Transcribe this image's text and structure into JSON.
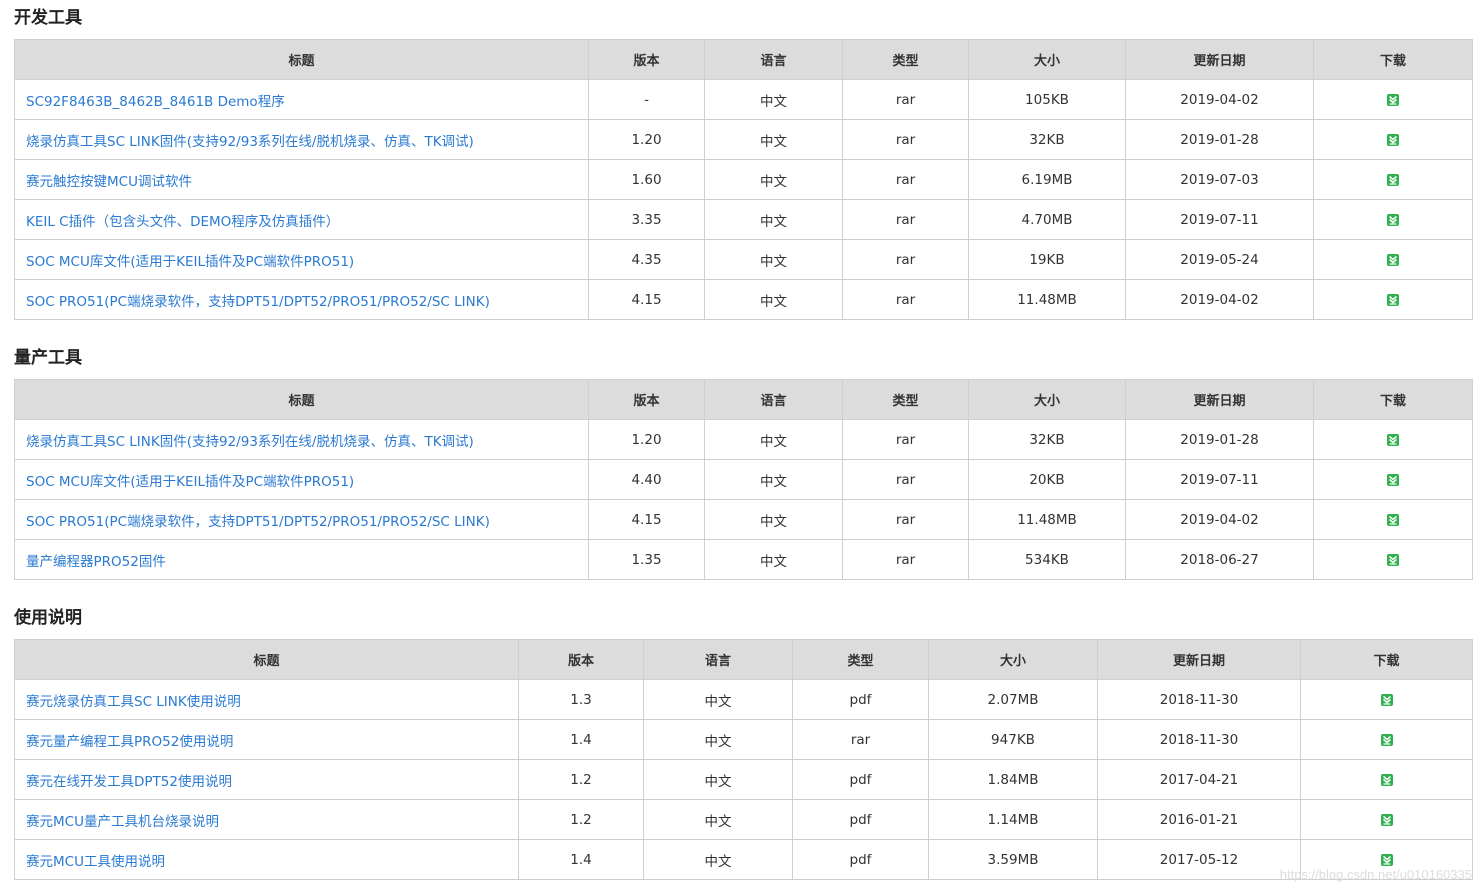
{
  "sections": [
    {
      "title": "开发工具",
      "headers": [
        "标题",
        "版本",
        "语言",
        "类型",
        "大小",
        "更新日期",
        "下载"
      ],
      "rows": [
        {
          "title": "SC92F8463B_8462B_8461B Demo程序",
          "version": "-",
          "lang": "中文",
          "type": "rar",
          "size": "105KB",
          "date": "2019-04-02"
        },
        {
          "title": "烧录仿真工具SC LINK固件(支持92/93系列在线/脱机烧录、仿真、TK调试)",
          "version": "1.20",
          "lang": "中文",
          "type": "rar",
          "size": "32KB",
          "date": "2019-01-28"
        },
        {
          "title": "赛元触控按键MCU调试软件",
          "version": "1.60",
          "lang": "中文",
          "type": "rar",
          "size": "6.19MB",
          "date": "2019-07-03"
        },
        {
          "title": "KEIL C插件（包含头文件、DEMO程序及仿真插件）",
          "version": "3.35",
          "lang": "中文",
          "type": "rar",
          "size": "4.70MB",
          "date": "2019-07-11"
        },
        {
          "title": "SOC MCU库文件(适用于KEIL插件及PC端软件PRO51)",
          "version": "4.35",
          "lang": "中文",
          "type": "rar",
          "size": "19KB",
          "date": "2019-05-24"
        },
        {
          "title": "SOC PRO51(PC端烧录软件，支持DPT51/DPT52/PRO51/PRO52/SC LINK)",
          "version": "4.15",
          "lang": "中文",
          "type": "rar",
          "size": "11.48MB",
          "date": "2019-04-02"
        }
      ]
    },
    {
      "title": "量产工具",
      "headers": [
        "标题",
        "版本",
        "语言",
        "类型",
        "大小",
        "更新日期",
        "下载"
      ],
      "rows": [
        {
          "title": "烧录仿真工具SC LINK固件(支持92/93系列在线/脱机烧录、仿真、TK调试)",
          "version": "1.20",
          "lang": "中文",
          "type": "rar",
          "size": "32KB",
          "date": "2019-01-28"
        },
        {
          "title": "SOC MCU库文件(适用于KEIL插件及PC端软件PRO51)",
          "version": "4.40",
          "lang": "中文",
          "type": "rar",
          "size": "20KB",
          "date": "2019-07-11"
        },
        {
          "title": "SOC PRO51(PC端烧录软件，支持DPT51/DPT52/PRO51/PRO52/SC LINK)",
          "version": "4.15",
          "lang": "中文",
          "type": "rar",
          "size": "11.48MB",
          "date": "2019-04-02"
        },
        {
          "title": "量产编程器PRO52固件",
          "version": "1.35",
          "lang": "中文",
          "type": "rar",
          "size": "534KB",
          "date": "2018-06-27"
        }
      ]
    },
    {
      "title": "使用说明",
      "headers": [
        "标题",
        "版本",
        "语言",
        "类型",
        "大小",
        "更新日期",
        "下载"
      ],
      "rows": [
        {
          "title": "赛元烧录仿真工具SC LINK使用说明",
          "version": "1.3",
          "lang": "中文",
          "type": "pdf",
          "size": "2.07MB",
          "date": "2018-11-30"
        },
        {
          "title": "赛元量产编程工具PRO52使用说明",
          "version": "1.4",
          "lang": "中文",
          "type": "rar",
          "size": "947KB",
          "date": "2018-11-30"
        },
        {
          "title": "赛元在线开发工具DPT52使用说明",
          "version": "1.2",
          "lang": "中文",
          "type": "pdf",
          "size": "1.84MB",
          "date": "2017-04-21"
        },
        {
          "title": "赛元MCU量产工具机台烧录说明",
          "version": "1.2",
          "lang": "中文",
          "type": "pdf",
          "size": "1.14MB",
          "date": "2016-01-21"
        },
        {
          "title": "赛元MCU工具使用说明",
          "version": "1.4",
          "lang": "中文",
          "type": "pdf",
          "size": "3.59MB",
          "date": "2017-05-12"
        }
      ]
    }
  ],
  "download_icon": "download-arrow-icon",
  "colors": {
    "link": "#2a7ad2",
    "header_bg": "#dcdcdc",
    "download_icon": "#2fb14d"
  },
  "watermark": "https://blog.csdn.net/u010160335"
}
